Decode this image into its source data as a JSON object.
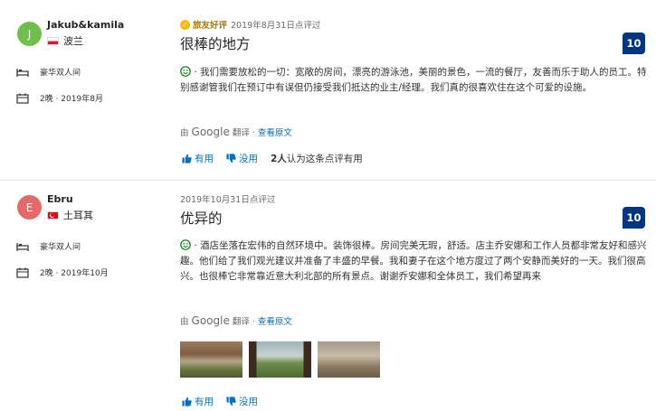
{
  "reviews": [
    {
      "avatar_letter": "J",
      "avatar_color": "#6fbf4a",
      "name": "Jakub&kamila",
      "country": "波兰",
      "room": "豪华双人间",
      "stay": "2晚 · 2019年8月",
      "badge": "旅友好评",
      "date": "2019年8月31日点评过",
      "title": "很棒的地方",
      "score": "10",
      "body": "· 我们需要放松的一切：宽敞的房间，漂亮的游泳池，美丽的景色，一流的餐厅，友善而乐于助人的员工。特别感谢管我们在预订中有误但仍接受我们抵达的业主/经理。我们真的很喜欢住在这个可爱的设施。",
      "translate_prefix": "由",
      "translate_brand": "Google",
      "translate_suffix": "翻译 ·",
      "view_original": "查看原文",
      "helpful": "有用",
      "not_helpful": "没用",
      "helpful_count": "2人",
      "helpful_count_text": "认为这条点评有用"
    },
    {
      "avatar_letter": "E",
      "avatar_color": "#e56a67",
      "name": "Ebru",
      "country": "土耳其",
      "room": "豪华双人间",
      "stay": "2晚 · 2019年10月",
      "date": "2019年10月31日点评过",
      "title": "优异的",
      "score": "10",
      "body": "· 酒店坐落在宏伟的自然环境中。装饰很棒。房间完美无瑕，舒适。店主乔安娜和工作人员都非常友好和感兴趣。他们给了我们观光建议并准备了丰盛的早餐。我和妻子在这个地方度过了两个安静而美好的一天。我们很高兴。也很棒它非常靠近意大利北部的所有景点。谢谢乔安娜和全体员工，我们希望再来",
      "translate_prefix": "由",
      "translate_brand": "Google",
      "translate_suffix": "翻译 ·",
      "view_original": "查看原文",
      "helpful": "有用",
      "not_helpful": "没用",
      "photos": [
        "photo-1",
        "photo-2",
        "photo-3"
      ]
    }
  ],
  "colors": {
    "link": "#0071c2",
    "score_bg": "#003580",
    "positive_icon": "#008009",
    "badge": "#febb02"
  }
}
